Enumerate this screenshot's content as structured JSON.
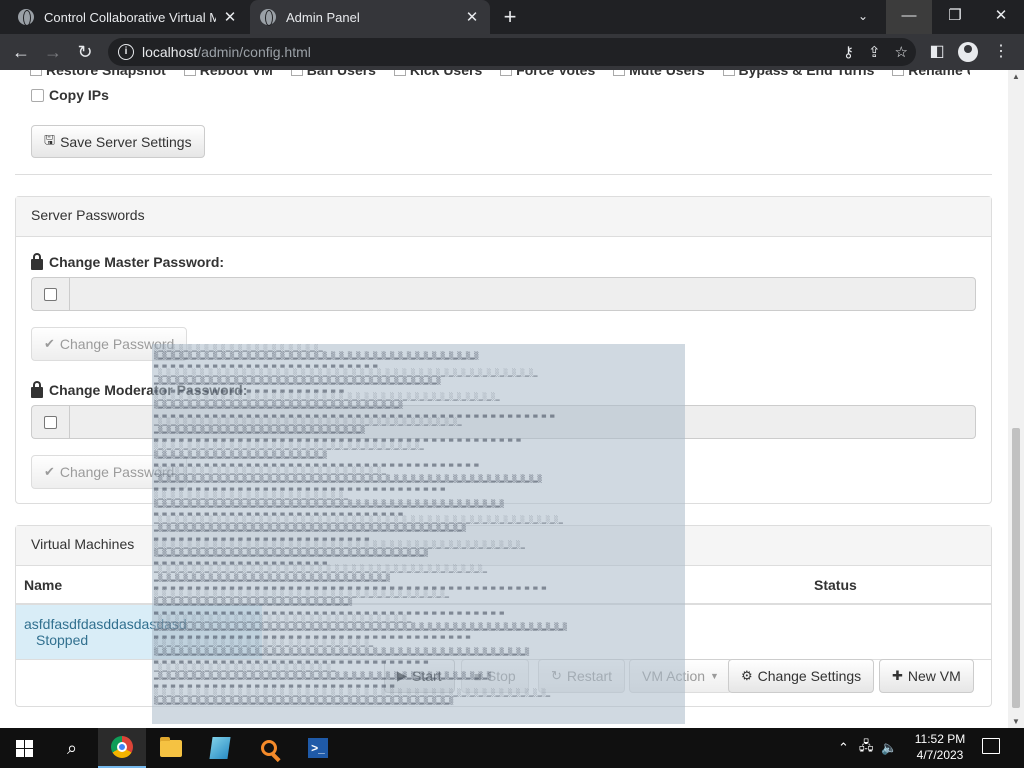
{
  "browser": {
    "tabs": [
      {
        "title": "Control Collaborative Virtual Mac",
        "close": "✕"
      },
      {
        "title": "Admin Panel",
        "close": "✕"
      }
    ],
    "url_host": "localhost",
    "url_path": "/admin/config.html"
  },
  "page": {
    "cut_options": [
      "Restore Snapshot",
      "Reboot VM",
      "Ban Users",
      "Kick Users",
      "Force Votes",
      "Mute Users",
      "Bypass & End Turns",
      "Rename Users"
    ],
    "copy_ips_label": "Copy IPs",
    "save_button": "Save Server Settings",
    "passwords_panel": {
      "heading": "Server Passwords",
      "master_label": "Change Master Password:",
      "moderator_label": "Change Moderator Password:",
      "change_button": "Change Password"
    },
    "vm_panel": {
      "heading": "Virtual Machines",
      "columns": {
        "name": "Name",
        "status": "Status"
      },
      "rows": [
        {
          "name": "asfdfasdfdasddasdasdasd",
          "status": "Stopped"
        }
      ],
      "buttons": {
        "start": "Start",
        "stop": "Stop",
        "restart": "Restart",
        "vm_action": "VM Action",
        "change_settings": "Change Settings",
        "new_vm": "New VM"
      }
    }
  },
  "taskbar": {
    "time": "11:52 PM",
    "date": "4/7/2023"
  },
  "colors": {
    "tab_bar": "#202124",
    "toolbar": "#35363a",
    "selected_row": "#d9edf7"
  }
}
